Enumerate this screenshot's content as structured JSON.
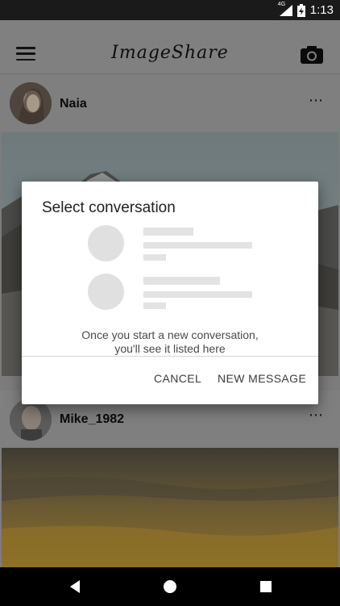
{
  "status_bar": {
    "network_label": "4G",
    "time": "1:13"
  },
  "app_bar": {
    "title": "ImageShare"
  },
  "posts": [
    {
      "username": "Naia",
      "more": "⋯"
    },
    {
      "username": "Mike_1982",
      "more": "⋯"
    }
  ],
  "dialog": {
    "title": "Select conversation",
    "empty_line_1": "Once you start a new conversation,",
    "empty_line_2": "you'll see it listed here",
    "cancel_label": "CANCEL",
    "new_message_label": "NEW MESSAGE"
  },
  "icons": {
    "menu": "menu-icon",
    "camera": "camera-icon",
    "back": "back-icon",
    "home": "home-icon",
    "recents": "recents-icon"
  },
  "colors": {
    "scrim_background": "#7f7f7f",
    "dialog_background": "#ffffff",
    "placeholder": "#e0e0e0"
  }
}
